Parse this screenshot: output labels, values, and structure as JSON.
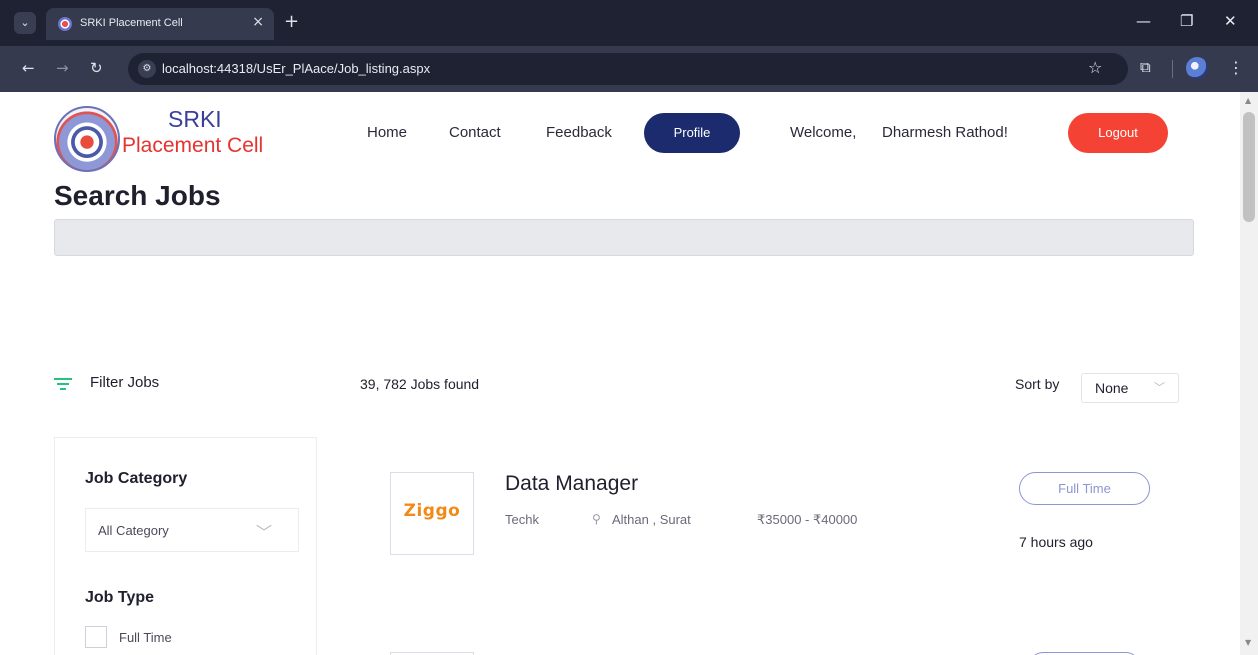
{
  "browser": {
    "tab_title": "SRKI Placement Cell",
    "url": "localhost:44318/UsEr_PlAace/Job_listing.aspx",
    "icons": {
      "tab_menu": "chevron-down-icon",
      "close": "close-icon",
      "new_tab": "plus-icon",
      "back": "arrow-left-icon",
      "forward": "arrow-right-icon",
      "reload": "reload-icon",
      "site_info": "site-info-icon",
      "bookmark": "star-icon",
      "extensions": "puzzle-icon",
      "menu": "kebab-icon"
    }
  },
  "header": {
    "brand_line1": "SRKI",
    "brand_line2": "Placement Cell",
    "nav": [
      "Home",
      "Contact",
      "Feedback"
    ],
    "profile_label": "Profile",
    "welcome_text": "Welcome,",
    "user_name": "Dharmesh Rathod!",
    "logout_label": "Logout"
  },
  "search": {
    "title": "Search Jobs",
    "value": ""
  },
  "results": {
    "filter_label": "Filter Jobs",
    "jobs_found": "39, 782 Jobs found",
    "sort_label": "Sort by",
    "sort_value": "None"
  },
  "sidebar": {
    "category_heading": "Job Category",
    "category_value": "All Category",
    "type_heading": "Job Type",
    "type_options": [
      "Full Time"
    ]
  },
  "jobs": [
    {
      "company_logo_text": "Ziggo",
      "title": "Data Manager",
      "company": "Techk",
      "location": "Althan , Surat",
      "salary": "₹35000 - ₹40000",
      "type": "Full Time",
      "posted": "7 hours ago"
    }
  ],
  "colors": {
    "brand_blue": "#3b3f9a",
    "brand_red": "#e3342f",
    "profile_btn": "#1c2a6e",
    "logout_btn": "#f44335",
    "filter_icon": "#26c281",
    "badge": "#8e95d2",
    "company_logo": "#f28a17"
  }
}
